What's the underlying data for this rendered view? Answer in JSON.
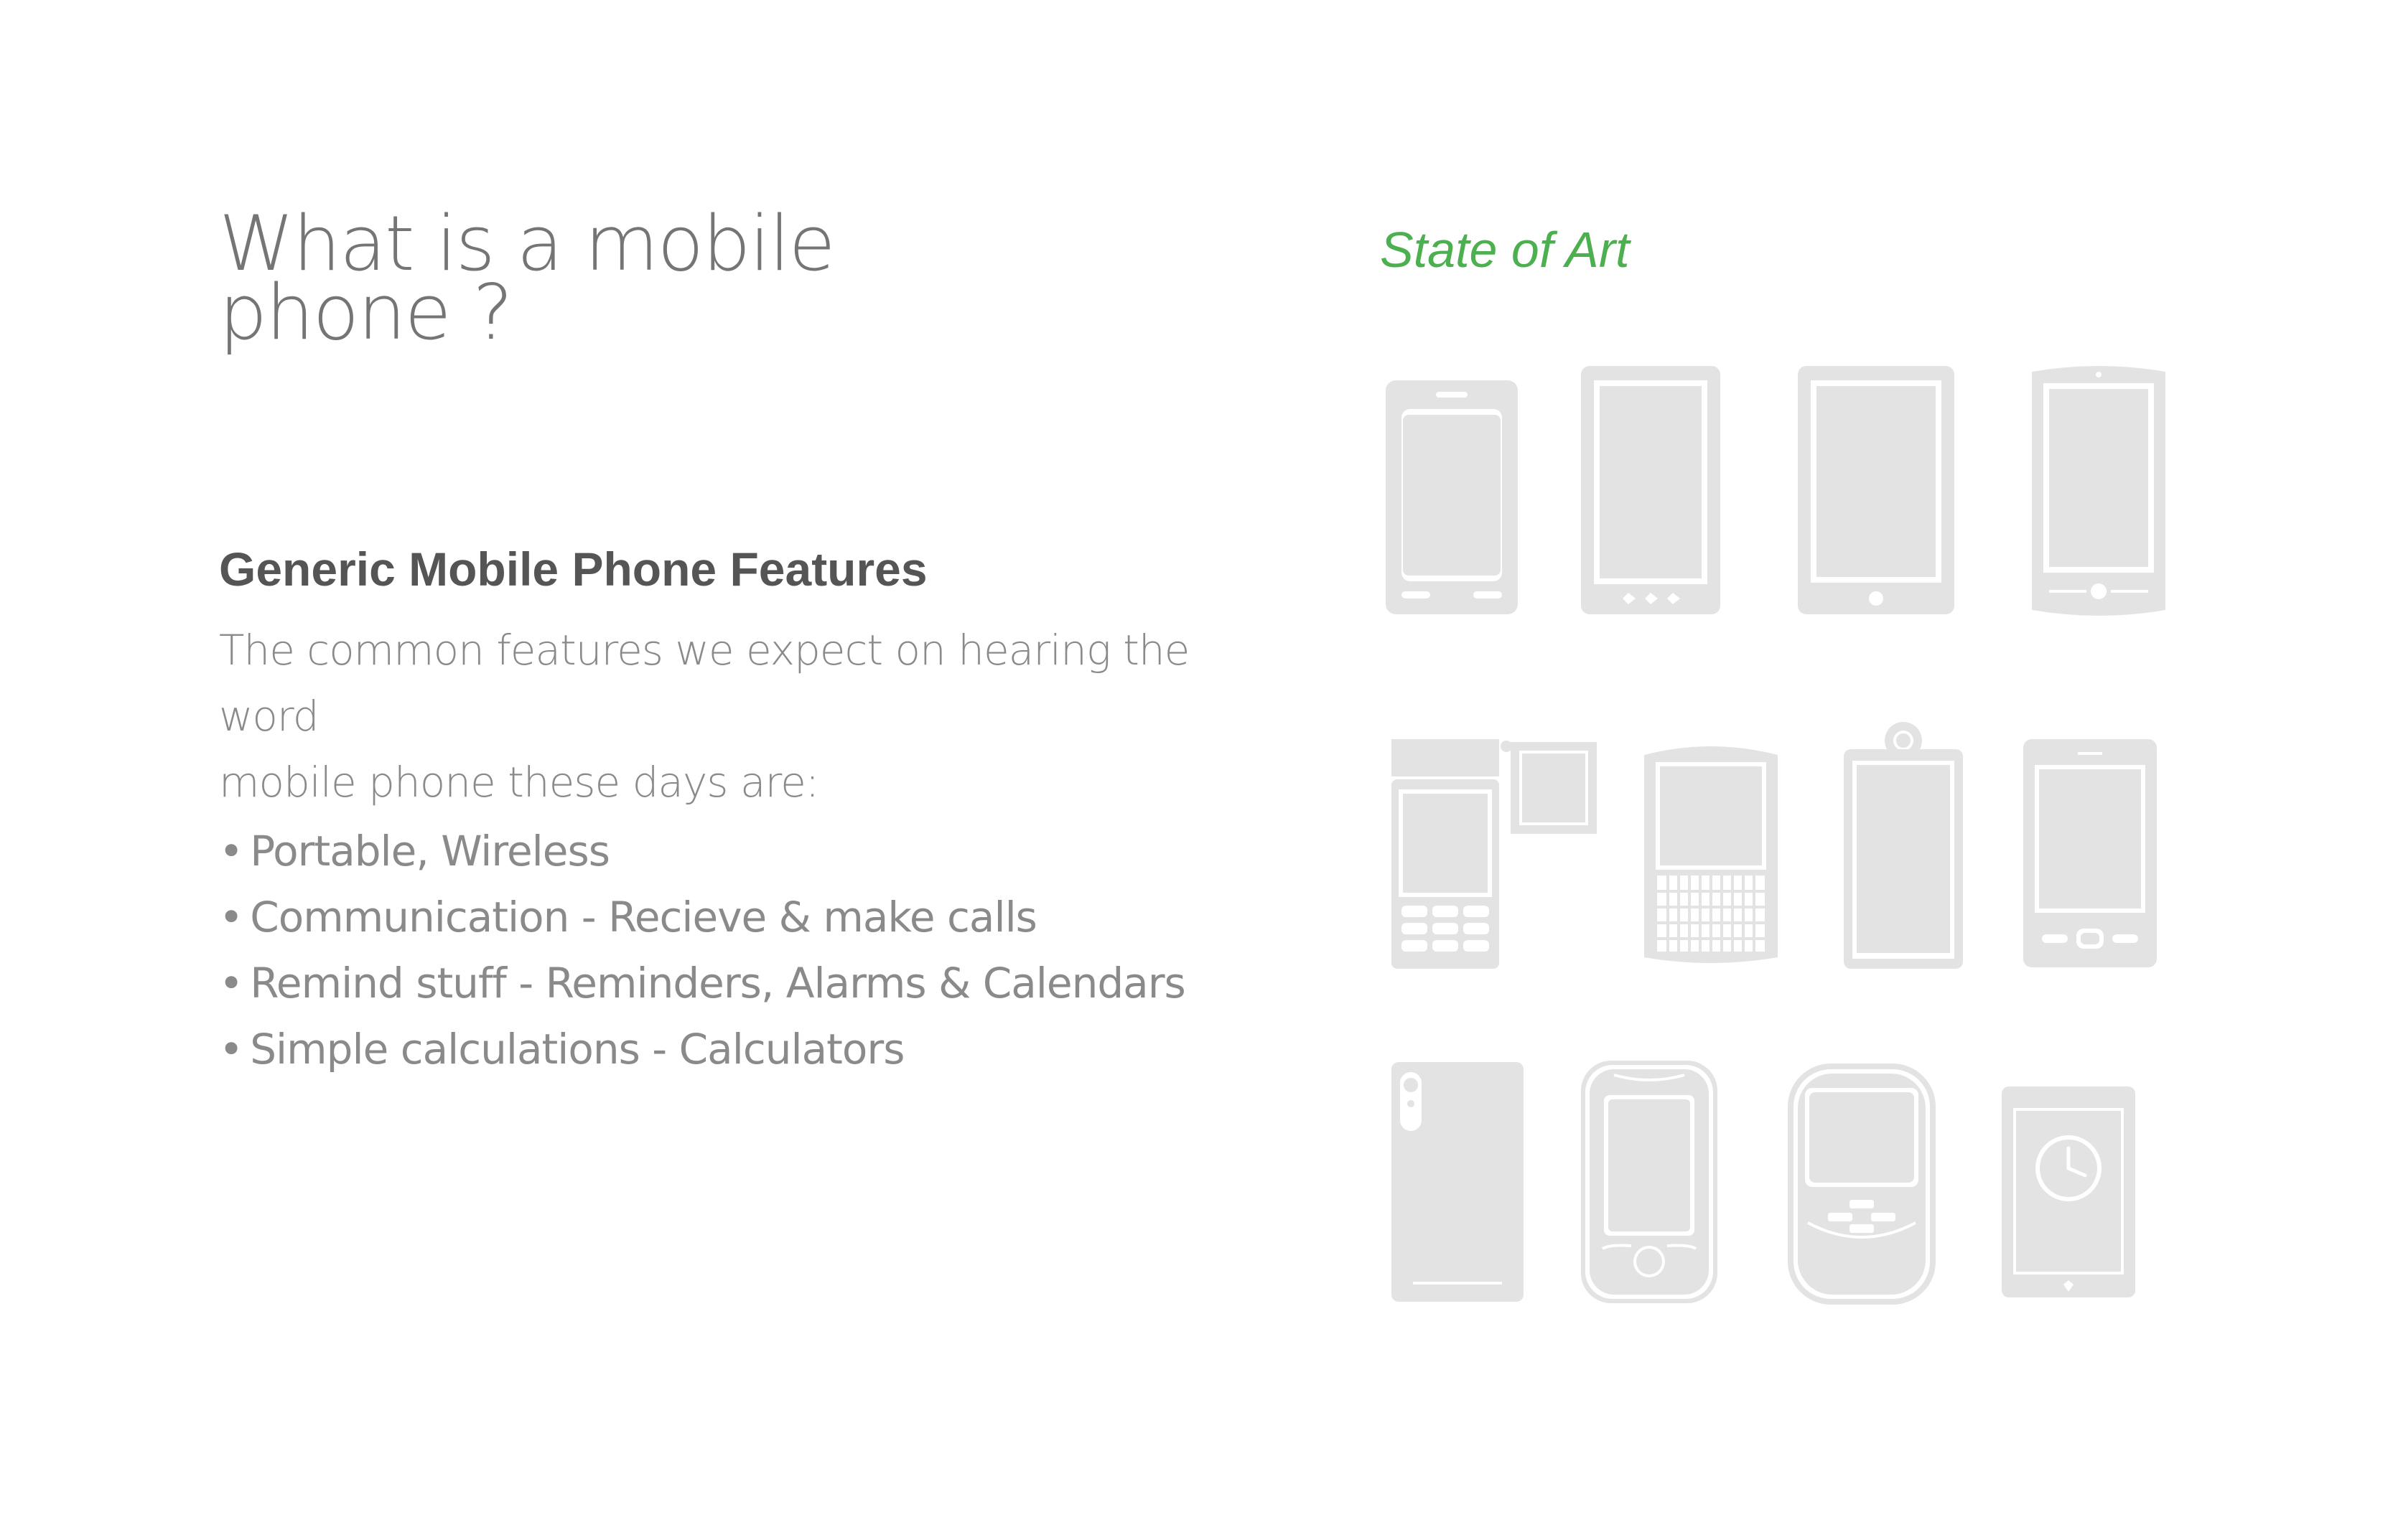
{
  "title": {
    "line1": "What is a mobile",
    "line2": "phone ?"
  },
  "section": {
    "heading": "Generic Mobile Phone Features",
    "intro_line1": "The common features we expect on hearing the word",
    "intro_line2": "mobile phone these days are:",
    "bullet_symbol": "•",
    "features": [
      "Portable, Wireless",
      "Communication - Recieve & make calls",
      "Remind stuff - Reminders, Alarms & Calendars",
      "Simple calculations - Calculators"
    ]
  },
  "state_of_art": {
    "title": "State of Art"
  },
  "colors": {
    "accent": "#4CAF50",
    "title_text": "#757575",
    "heading_text": "#555555",
    "body_text": "#8a8a8a",
    "icon_fill": "#e3e3e3",
    "background": "#ffffff"
  },
  "icons": [
    "classic-smartphone-icon",
    "android-phone-icon",
    "tablet-phone-icon",
    "curved-phone-icon",
    "flip-camera-phone-icon",
    "qwerty-phone-icon",
    "ring-top-phone-icon",
    "feature-phone-icon",
    "phone-back-icon",
    "round-phone-icon",
    "blackberry-phone-icon",
    "smartwatch-icon"
  ]
}
